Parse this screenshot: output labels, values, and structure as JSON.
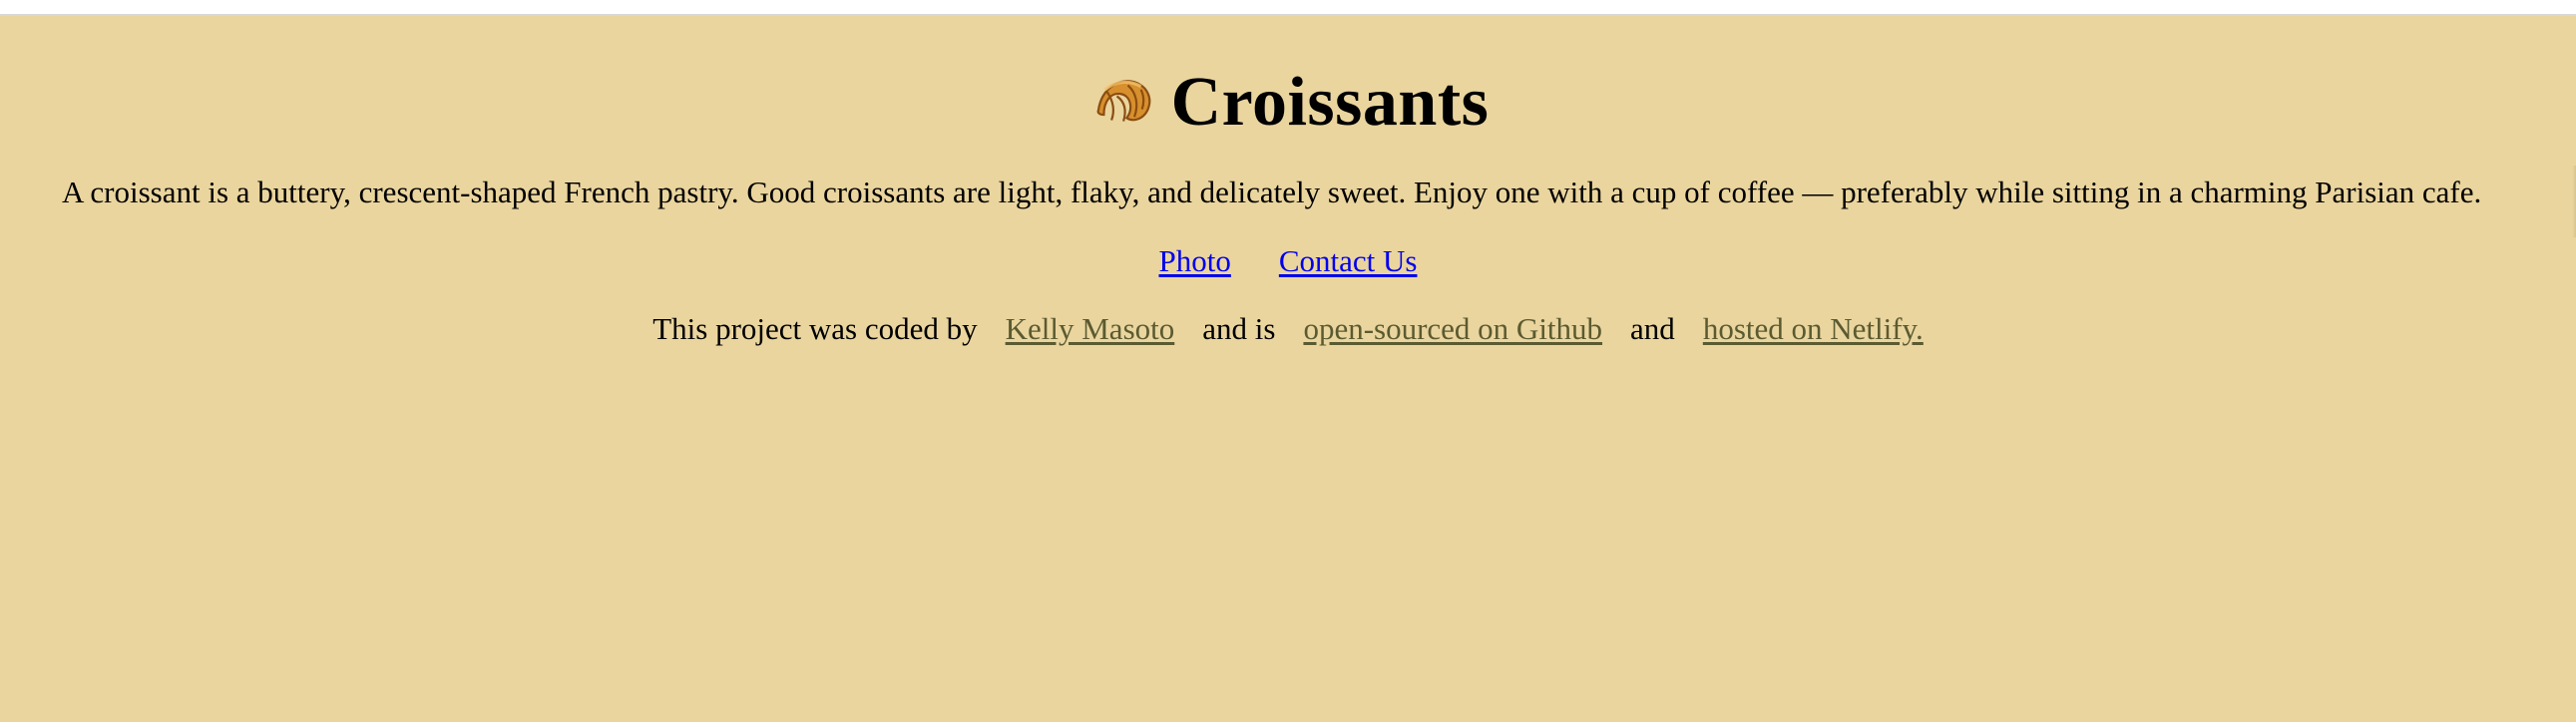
{
  "page": {
    "background_color": "#ead59e",
    "title": "Croissants",
    "title_icon": "croissant-icon",
    "description": "A croissant is a buttery, crescent-shaped French pastry. Good croissants are light, flaky, and delicately sweet. Enjoy one with a cup of coffee — preferably while sitting in a charming Parisian cafe.",
    "nav": {
      "photo_label": "Photo",
      "contact_label": "Contact Us",
      "link_color": "#0000ee"
    },
    "credits": {
      "prefix": "This project was coded by",
      "author_label": "Kelly Masoto",
      "middle_1": "and is",
      "github_label": "open-sourced on Github",
      "middle_2": "and",
      "netlify_label": "hosted on Netlify.",
      "link_color": "#5b5a31"
    }
  }
}
